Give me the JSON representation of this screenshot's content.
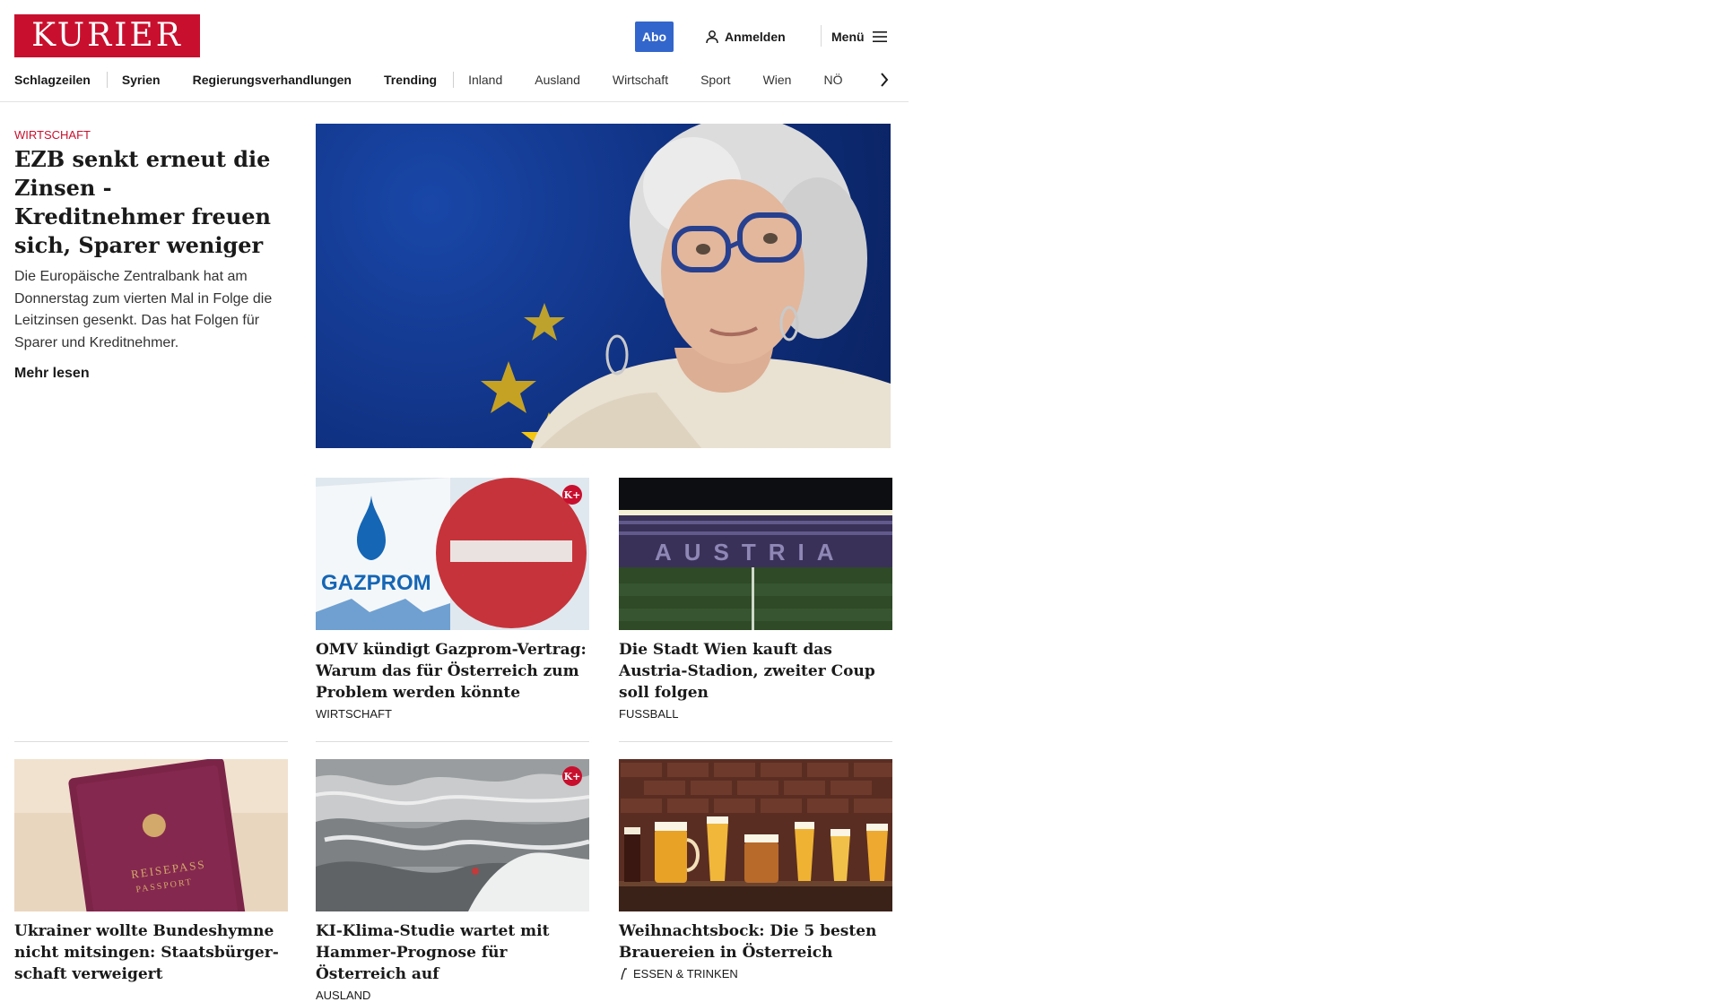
{
  "header": {
    "logo_text": "KURIER",
    "abo_label": "Abo",
    "login_label": "Anmelden",
    "menu_label": "Menü"
  },
  "nav": {
    "items": [
      "Schlagzeilen",
      "Syrien",
      "Regierungsverhandlungen",
      "Trending",
      "Inland",
      "Ausland",
      "Wirtschaft",
      "Sport",
      "Wien",
      "NÖ"
    ]
  },
  "lead": {
    "kicker": "WIRTSCHAFT",
    "title": "EZB senkt erneut die Zin­sen - Kreditnehmer freuen sich, Sparer weniger",
    "teaser": "Die Europäische Zentralbank hat am Donnerstag zum vierten Mal in Folge die Leitzinsen gesenkt. Das hat Folgen für Sparer und Kreditnehmer.",
    "read_more": "Mehr lesen"
  },
  "cards": [
    {
      "title": "OMV kündigt Gazprom-Vertrag: Warum das für Österreich zum Problem werden könnte",
      "category": "WIRTSCHAFT",
      "badge": "K+"
    },
    {
      "title": "Die Stadt Wien kauft das Austria-Stadion, zweiter Coup soll folgen",
      "category": "FUSSBALL"
    },
    {
      "title": "Ukrainer wollte Bundeshymne nicht mitsingen: Staatsbürger­schaft verweigert",
      "category": ""
    },
    {
      "title": "KI-Klima-Studie wartet mit Ham­mer-Prognose für Österreich auf",
      "category": "AUSLAND",
      "badge": "K+"
    },
    {
      "title": "Weihnachtsbock: Die 5 besten Brauereien in Österreich",
      "category": "ESSEN & TRINKEN"
    }
  ],
  "images": {
    "gazprom_sign_text": "GAZPROM",
    "stadium_text": "AUSTRIA",
    "passport_text_1": "REISEPASS",
    "passport_text_2": "PASSPORT"
  },
  "colors": {
    "brand_red": "#c8102e",
    "abo_blue": "#3366cc"
  },
  "icons": {
    "login": "user-icon",
    "menu": "hamburger-icon",
    "nav_next": "chevron-right-icon",
    "category_food": "fork-icon"
  }
}
